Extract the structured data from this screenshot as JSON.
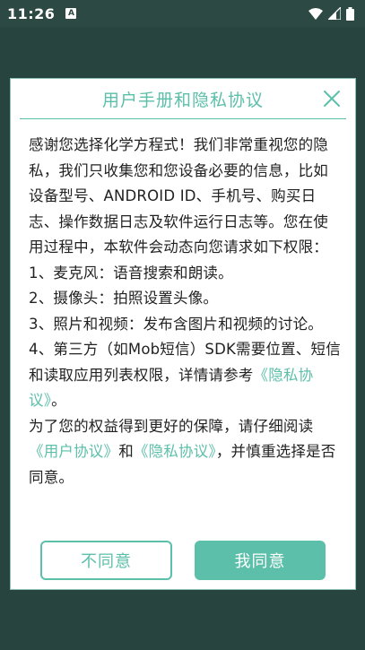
{
  "status_bar": {
    "time": "11:26",
    "notification_icon": "A"
  },
  "dialog": {
    "title": "用户手册和隐私协议",
    "paragraphs": {
      "intro": "感谢您选择化学方程式！我们非常重视您的隐私，我们只收集您和您设备必要的信息，比如设备型号、ANDROID ID、手机号、购买日志、操作数据日志及软件运行日志等。您在使用过程中，本软件会动态向您请求如下权限：",
      "item1": "1、麦克风：语音搜索和朗读。",
      "item2": "2、摄像头：拍照设置头像。",
      "item3": "3、照片和视频：发布含图片和视频的讨论。",
      "item4_text": "4、第三方（如Mob短信）SDK需要位置、短信和读取应用列表权限，详情请参考",
      "item4_link": "《隐私协议》",
      "item4_end": "。",
      "closing_text1": "为了您的权益得到更好的保障，请仔细阅读",
      "closing_link1": "《用户协议》",
      "closing_and": "和",
      "closing_link2": "《隐私协议》",
      "closing_text2": "，并慎重选择是否同意。"
    },
    "buttons": {
      "disagree": "不同意",
      "agree": "我同意"
    }
  },
  "colors": {
    "accent": "#5bbfa9",
    "background": "#27453e"
  }
}
